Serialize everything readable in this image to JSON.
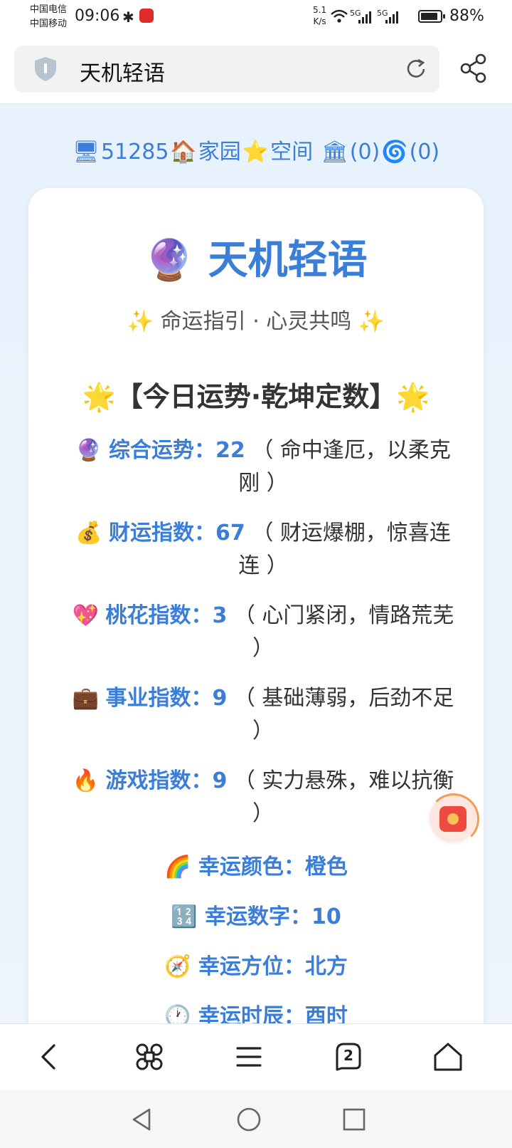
{
  "status_bar": {
    "carrier1": "中国电信",
    "carrier2": "中国移动",
    "time": "09:06",
    "net_speed_value": "5.1",
    "net_speed_unit": "K/s",
    "sig1": "5G",
    "sig2": "5G",
    "battery_text": "88%",
    "battery_level": 0.88
  },
  "browser": {
    "url_title": "天机轻语"
  },
  "top_nav": {
    "id": "51285",
    "home": "家园",
    "space": "空间",
    "count1": "(0)",
    "count2": "(0)"
  },
  "card": {
    "title_emoji": "🔮",
    "title": "天机轻语",
    "subtitle": "✨ 命运指引 · 心灵共鸣 ✨",
    "section_title": "🌟【今日运势·乾坤定数】🌟",
    "fortunes": [
      {
        "icon": "🔮",
        "label": "综合运势：",
        "value": "22",
        "desc": "（ 命中逢厄，以柔克刚 ）"
      },
      {
        "icon": "💰",
        "label": "财运指数：",
        "value": "67",
        "desc": "（ 财运爆棚，惊喜连连 ）"
      },
      {
        "icon": "💖",
        "label": "桃花指数：",
        "value": "3",
        "desc": "（ 心门紧闭，情路荒芜 ）"
      },
      {
        "icon": "💼",
        "label": "事业指数：",
        "value": "9",
        "desc": "（ 基础薄弱，后劲不足 ）"
      },
      {
        "icon": "🔥",
        "label": "游戏指数：",
        "value": "9",
        "desc": "（ 实力悬殊，难以抗衡 ）"
      }
    ],
    "lucky": [
      {
        "icon": "🌈",
        "text": "幸运颜色：橙色"
      },
      {
        "icon": "🔢",
        "text": "幸运数字：10"
      },
      {
        "icon": "🧭",
        "text": "幸运方位：北方"
      },
      {
        "icon": "🕐",
        "text": "幸运时辰：酉时"
      }
    ]
  },
  "toolbar": {
    "tabs_count": "2"
  },
  "icons": [
    "shield-icon",
    "reload-icon",
    "share-icon",
    "back-icon",
    "apps-icon",
    "menu-icon",
    "tabs-icon",
    "home-icon",
    "floating-redpacket-icon",
    "nav-back-icon",
    "nav-home-icon",
    "nav-recents-icon"
  ]
}
